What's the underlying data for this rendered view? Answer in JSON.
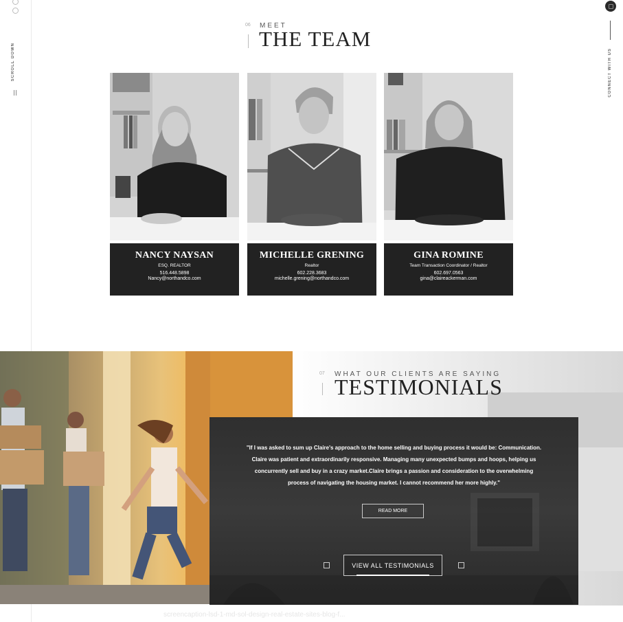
{
  "rails": {
    "scroll_label": "SCROLL DOWN",
    "connect_label": "CONNECT WITH US"
  },
  "team_section": {
    "number": "06",
    "kicker": "MEET",
    "title": "THE TEAM",
    "members": [
      {
        "name": "NANCY NAYSAN",
        "role": "ESQ. REALTOR",
        "phone": "516.448.5898",
        "email": "Nancy@northandco.com"
      },
      {
        "name": "MICHELLE GRENING",
        "role": "Realtor",
        "phone": "602.228.3683",
        "email": "michelle.grening@northandco.com"
      },
      {
        "name": "GINA ROMINE",
        "role": "Team Transaction Coordinator / Realtor",
        "phone": "602.697.0563",
        "email": "gina@claireackerman.com"
      }
    ]
  },
  "testimonials_section": {
    "number": "07",
    "kicker": "WHAT OUR CLIENTS ARE SAYING",
    "title": "TESTIMONIALS",
    "quote": "\"If I was asked to sum up Claire's approach to the home selling and buying process it would be: Communication. Claire was patient and extraordinarily responsive. Managing many unexpected bumps and hoops, helping us concurrently sell and buy in a crazy market.Claire brings a passion and consideration to the overwhelming process of navigating the housing market. I cannot recommend her more highly.\"",
    "read_more": "READ MORE",
    "view_all": "VIEW ALL TESTIMONIALS"
  },
  "footer_ghost_text": "screencaption-lsd-1-md-sol-design-real-estate-sites-blog-f..."
}
